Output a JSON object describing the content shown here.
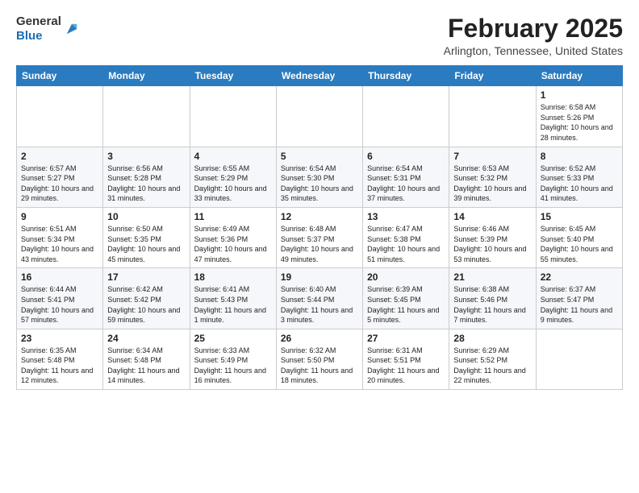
{
  "header": {
    "logo_line1": "General",
    "logo_line2": "Blue",
    "month_title": "February 2025",
    "location": "Arlington, Tennessee, United States"
  },
  "weekdays": [
    "Sunday",
    "Monday",
    "Tuesday",
    "Wednesday",
    "Thursday",
    "Friday",
    "Saturday"
  ],
  "weeks": [
    [
      {
        "day": "",
        "info": ""
      },
      {
        "day": "",
        "info": ""
      },
      {
        "day": "",
        "info": ""
      },
      {
        "day": "",
        "info": ""
      },
      {
        "day": "",
        "info": ""
      },
      {
        "day": "",
        "info": ""
      },
      {
        "day": "1",
        "info": "Sunrise: 6:58 AM\nSunset: 5:26 PM\nDaylight: 10 hours and 28 minutes."
      }
    ],
    [
      {
        "day": "2",
        "info": "Sunrise: 6:57 AM\nSunset: 5:27 PM\nDaylight: 10 hours and 29 minutes."
      },
      {
        "day": "3",
        "info": "Sunrise: 6:56 AM\nSunset: 5:28 PM\nDaylight: 10 hours and 31 minutes."
      },
      {
        "day": "4",
        "info": "Sunrise: 6:55 AM\nSunset: 5:29 PM\nDaylight: 10 hours and 33 minutes."
      },
      {
        "day": "5",
        "info": "Sunrise: 6:54 AM\nSunset: 5:30 PM\nDaylight: 10 hours and 35 minutes."
      },
      {
        "day": "6",
        "info": "Sunrise: 6:54 AM\nSunset: 5:31 PM\nDaylight: 10 hours and 37 minutes."
      },
      {
        "day": "7",
        "info": "Sunrise: 6:53 AM\nSunset: 5:32 PM\nDaylight: 10 hours and 39 minutes."
      },
      {
        "day": "8",
        "info": "Sunrise: 6:52 AM\nSunset: 5:33 PM\nDaylight: 10 hours and 41 minutes."
      }
    ],
    [
      {
        "day": "9",
        "info": "Sunrise: 6:51 AM\nSunset: 5:34 PM\nDaylight: 10 hours and 43 minutes."
      },
      {
        "day": "10",
        "info": "Sunrise: 6:50 AM\nSunset: 5:35 PM\nDaylight: 10 hours and 45 minutes."
      },
      {
        "day": "11",
        "info": "Sunrise: 6:49 AM\nSunset: 5:36 PM\nDaylight: 10 hours and 47 minutes."
      },
      {
        "day": "12",
        "info": "Sunrise: 6:48 AM\nSunset: 5:37 PM\nDaylight: 10 hours and 49 minutes."
      },
      {
        "day": "13",
        "info": "Sunrise: 6:47 AM\nSunset: 5:38 PM\nDaylight: 10 hours and 51 minutes."
      },
      {
        "day": "14",
        "info": "Sunrise: 6:46 AM\nSunset: 5:39 PM\nDaylight: 10 hours and 53 minutes."
      },
      {
        "day": "15",
        "info": "Sunrise: 6:45 AM\nSunset: 5:40 PM\nDaylight: 10 hours and 55 minutes."
      }
    ],
    [
      {
        "day": "16",
        "info": "Sunrise: 6:44 AM\nSunset: 5:41 PM\nDaylight: 10 hours and 57 minutes."
      },
      {
        "day": "17",
        "info": "Sunrise: 6:42 AM\nSunset: 5:42 PM\nDaylight: 10 hours and 59 minutes."
      },
      {
        "day": "18",
        "info": "Sunrise: 6:41 AM\nSunset: 5:43 PM\nDaylight: 11 hours and 1 minute."
      },
      {
        "day": "19",
        "info": "Sunrise: 6:40 AM\nSunset: 5:44 PM\nDaylight: 11 hours and 3 minutes."
      },
      {
        "day": "20",
        "info": "Sunrise: 6:39 AM\nSunset: 5:45 PM\nDaylight: 11 hours and 5 minutes."
      },
      {
        "day": "21",
        "info": "Sunrise: 6:38 AM\nSunset: 5:46 PM\nDaylight: 11 hours and 7 minutes."
      },
      {
        "day": "22",
        "info": "Sunrise: 6:37 AM\nSunset: 5:47 PM\nDaylight: 11 hours and 9 minutes."
      }
    ],
    [
      {
        "day": "23",
        "info": "Sunrise: 6:35 AM\nSunset: 5:48 PM\nDaylight: 11 hours and 12 minutes."
      },
      {
        "day": "24",
        "info": "Sunrise: 6:34 AM\nSunset: 5:48 PM\nDaylight: 11 hours and 14 minutes."
      },
      {
        "day": "25",
        "info": "Sunrise: 6:33 AM\nSunset: 5:49 PM\nDaylight: 11 hours and 16 minutes."
      },
      {
        "day": "26",
        "info": "Sunrise: 6:32 AM\nSunset: 5:50 PM\nDaylight: 11 hours and 18 minutes."
      },
      {
        "day": "27",
        "info": "Sunrise: 6:31 AM\nSunset: 5:51 PM\nDaylight: 11 hours and 20 minutes."
      },
      {
        "day": "28",
        "info": "Sunrise: 6:29 AM\nSunset: 5:52 PM\nDaylight: 11 hours and 22 minutes."
      },
      {
        "day": "",
        "info": ""
      }
    ]
  ]
}
